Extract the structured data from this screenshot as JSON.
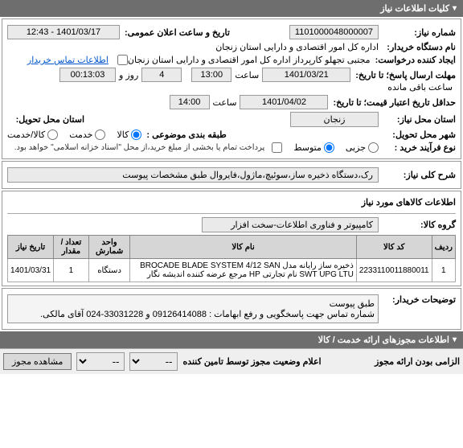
{
  "header": {
    "title": "کلیات اطلاعات نیاز"
  },
  "f": {
    "need_no_lbl": "شماره نیاز:",
    "need_no": "1101000048000007",
    "announce_lbl": "تاریخ و ساعت اعلان عمومی:",
    "announce": "1401/03/17 - 12:43",
    "buyer_org_lbl": "نام دستگاه خریدار:",
    "buyer_org": "اداره کل امور اقتصادی و دارایی استان زنجان",
    "requester_lbl": "ایجاد کننده درخواست:",
    "requester": "مجتبی تجهلو کارپرداز اداره کل امور اقتصادی و دارایی استان زنجان",
    "contact_link": "اطلاعات تماس خریدار",
    "deadline_lbl": "مهلت ارسال پاسخ؛ تا تاریخ:",
    "deadline_date": "1401/03/21",
    "deadline_time": "13:00",
    "time_lbl": "ساعت",
    "days_left": "4",
    "days_lbl": "روز و",
    "hms_left": "00:13:03",
    "remain_lbl": "ساعت باقی مانده",
    "validity_lbl": "حداقل تاریخ اعتبار قیمت؛ تا تاریخ:",
    "validity_date": "1401/04/02",
    "validity_time": "14:00",
    "need_loc_lbl": "استان محل نیاز:",
    "need_loc": "زنجان",
    "deliver_city_lbl": "شهر محل تحویل:",
    "deliver_prov_lbl": "استان محل تحویل:",
    "class_lbl": "طبقه بندی موضوعی :",
    "c_goods": "کالا",
    "c_service": "خدمت",
    "c_both": "کالا/خدمت",
    "proc_lbl": "نوع فرآیند خرید :",
    "p_low": "جزیی",
    "p_mid": "متوسط",
    "pay_note": "پرداخت تمام یا بخشی از مبلغ خرید،از محل \"اسناد خزانه اسلامی\" خواهد بود."
  },
  "desc": {
    "lbl": "شرح کلی نیاز:",
    "txt": "رک،دستگاه ذخیره ساز،سوئیچ،ماژول،فایروال طبق مشخصات پیوست"
  },
  "items": {
    "title": "اطلاعات کالاهای مورد نیاز",
    "group_lbl": "گروه کالا:",
    "group": "کامپیوتر و فناوری اطلاعات-سخت افزار",
    "cols": {
      "row": "ردیف",
      "code": "کد کالا",
      "name": "نام کالا",
      "unit": "واحد شمارش",
      "qty": "تعداد / مقدار",
      "date": "تاریخ نیاز"
    },
    "row": {
      "n": "1",
      "code": "2233110011880011",
      "name": "ذخیره ساز رایانه مدل BROCADE BLADE SYSTEM 4/12 SAN SWT UPG LTU نام تجارتی HP مرجع عرضه کننده اندیشه نگار",
      "unit": "دستگاه",
      "qty": "1",
      "date": "1401/03/31"
    }
  },
  "buyernote": {
    "lbl": "توضیحات خریدار:",
    "l1": "طبق پیوست",
    "l2": "شماره تماس جهت پاسخگویی و رفع ابهامات :  09126414088 و 33031228-024 آقای مالکی."
  },
  "header2": {
    "title": "اطلاعات مجوزهای ارائه خدمت / کالا"
  },
  "footer": {
    "mandatory_lbl": "الزامی بودن ارائه مجوز",
    "status_lbl": "اعلام وضعیت مجوز توسط تامین کننده",
    "dash": "--",
    "view_btn": "مشاهده مجوز"
  }
}
